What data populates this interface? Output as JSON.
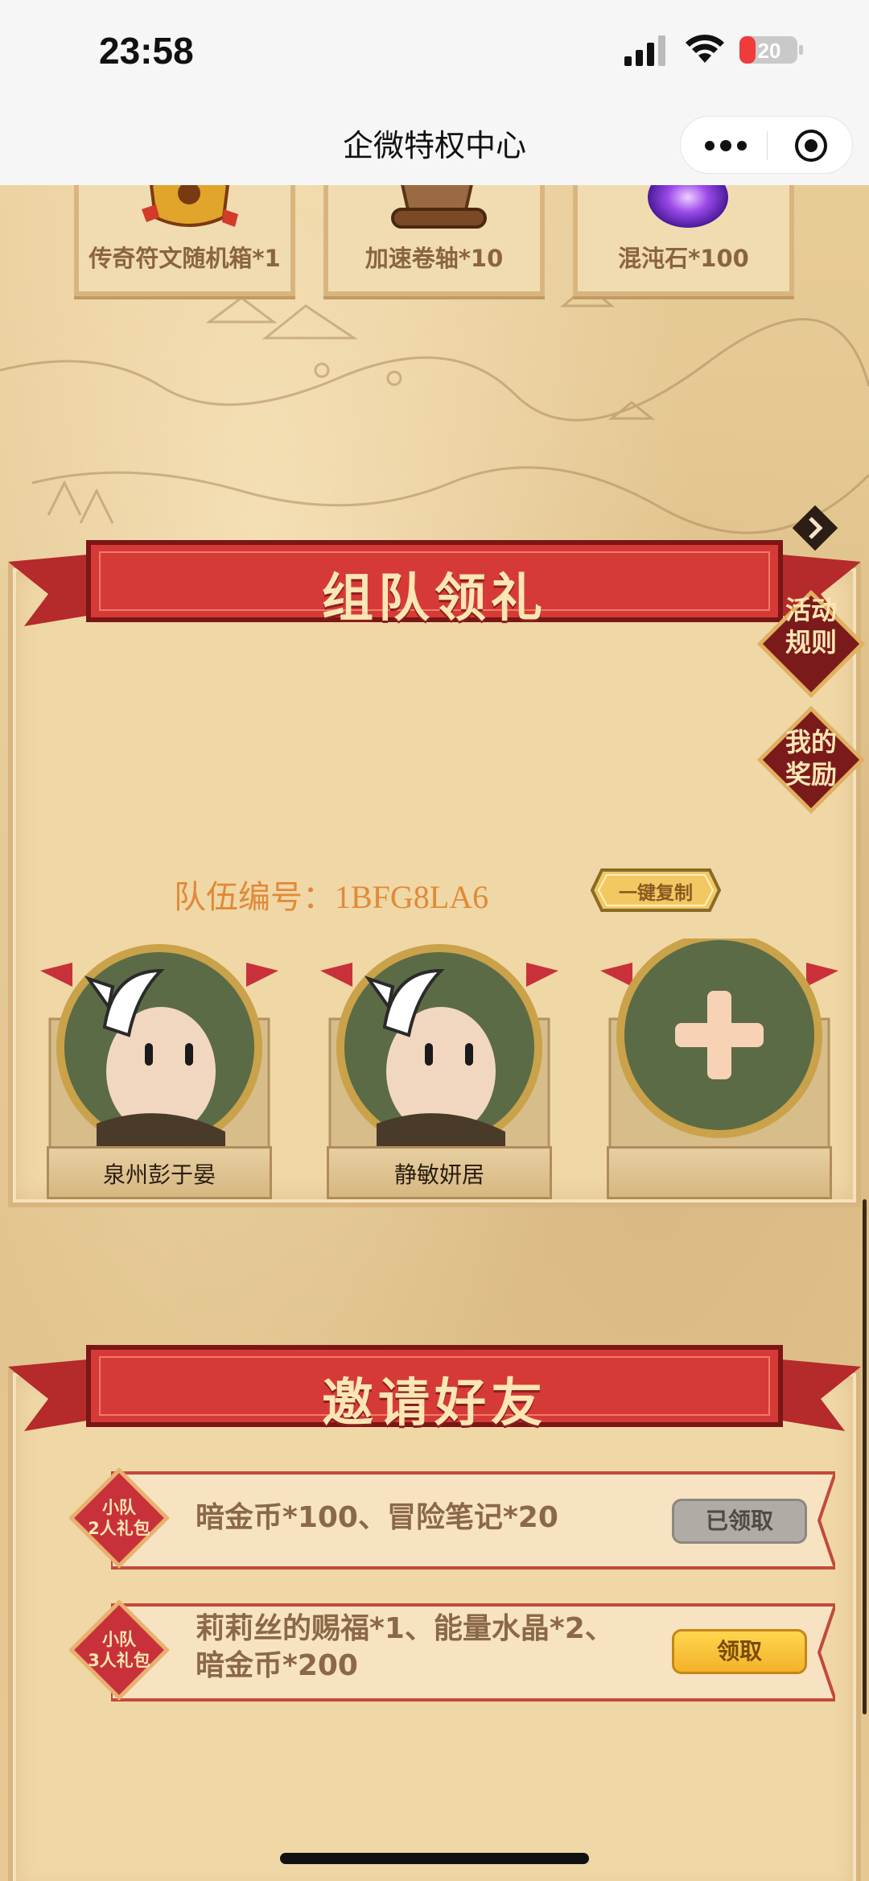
{
  "status_bar": {
    "time": "23:58",
    "battery": "20",
    "battery_color": "#ef3b3b"
  },
  "nav": {
    "title": "企微特权中心",
    "more_icon": "more-dots-icon",
    "close_icon": "target-circle-icon"
  },
  "rewards": [
    {
      "label": "传奇符文随机箱*1",
      "icon": "rune-chest-icon"
    },
    {
      "label": "加速卷轴*10",
      "icon": "scroll-icon"
    },
    {
      "label": "混沌石*100",
      "icon": "chaos-stone-icon"
    }
  ],
  "team": {
    "title": "组队领礼",
    "rules_label": "活动规则",
    "my_rewards_label": "我的奖励",
    "team_id_text": "队伍编号：1BFG8LA6",
    "copy_label": "一键复制",
    "members": [
      {
        "name": "泉州彭于晏"
      },
      {
        "name": "静敏妍居"
      },
      {
        "name": ""
      }
    ]
  },
  "invite": {
    "title": "邀请好友",
    "gifts": [
      {
        "badge_line1": "小队",
        "badge_line2": "2人礼包",
        "desc_line1": "暗金币*100、冒险笔记*20",
        "desc_line2": "",
        "button": "已领取",
        "claimed": true
      },
      {
        "badge_line1": "小队",
        "badge_line2": "3人礼包",
        "desc_line1": "莉莉丝的赐福*1、能量水晶*2、",
        "desc_line2": "暗金币*200",
        "button": "领取",
        "claimed": false
      }
    ]
  },
  "colors": {
    "ribbon_red": "#d63a36",
    "team_id_orange": "#e08a38",
    "claim_yellow": "#f8c43a"
  }
}
